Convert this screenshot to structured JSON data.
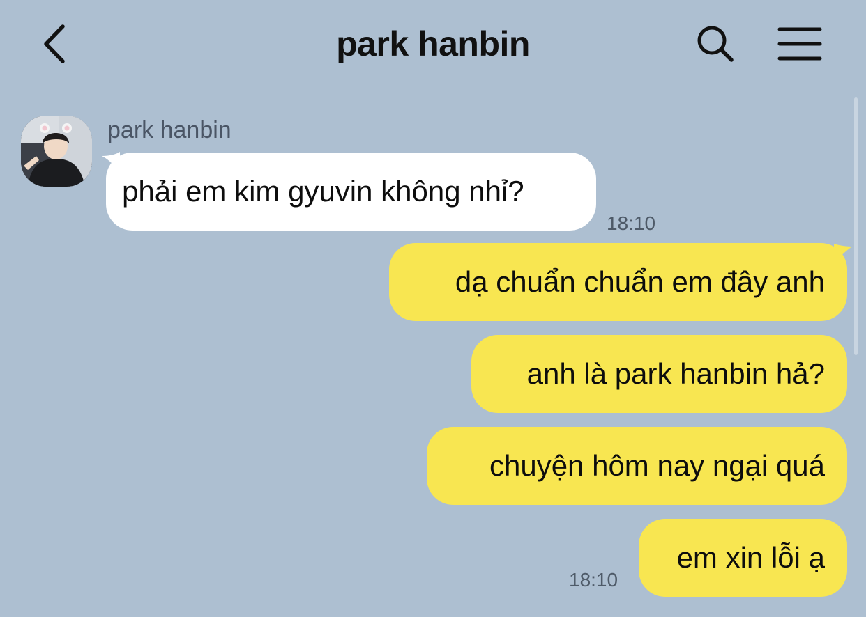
{
  "header": {
    "title": "park hanbin",
    "back_icon": "chevron-left-icon",
    "search_icon": "search-icon",
    "menu_icon": "hamburger-menu-icon"
  },
  "colors": {
    "background": "#adbfd1",
    "incoming_bubble": "#ffffff",
    "outgoing_bubble": "#f8e651",
    "timestamp": "#4e5a68"
  },
  "messages": {
    "sender_name": "park hanbin",
    "incoming": [
      {
        "text": "phải em kim gyuvin không nhỉ?",
        "time": "18:10"
      }
    ],
    "outgoing": [
      {
        "text": "dạ chuẩn chuẩn em đây anh"
      },
      {
        "text": "anh là park hanbin hả?"
      },
      {
        "text": "chuyện hôm nay ngại quá"
      },
      {
        "text": "em xin lỗi ạ",
        "time": "18:10"
      }
    ]
  }
}
